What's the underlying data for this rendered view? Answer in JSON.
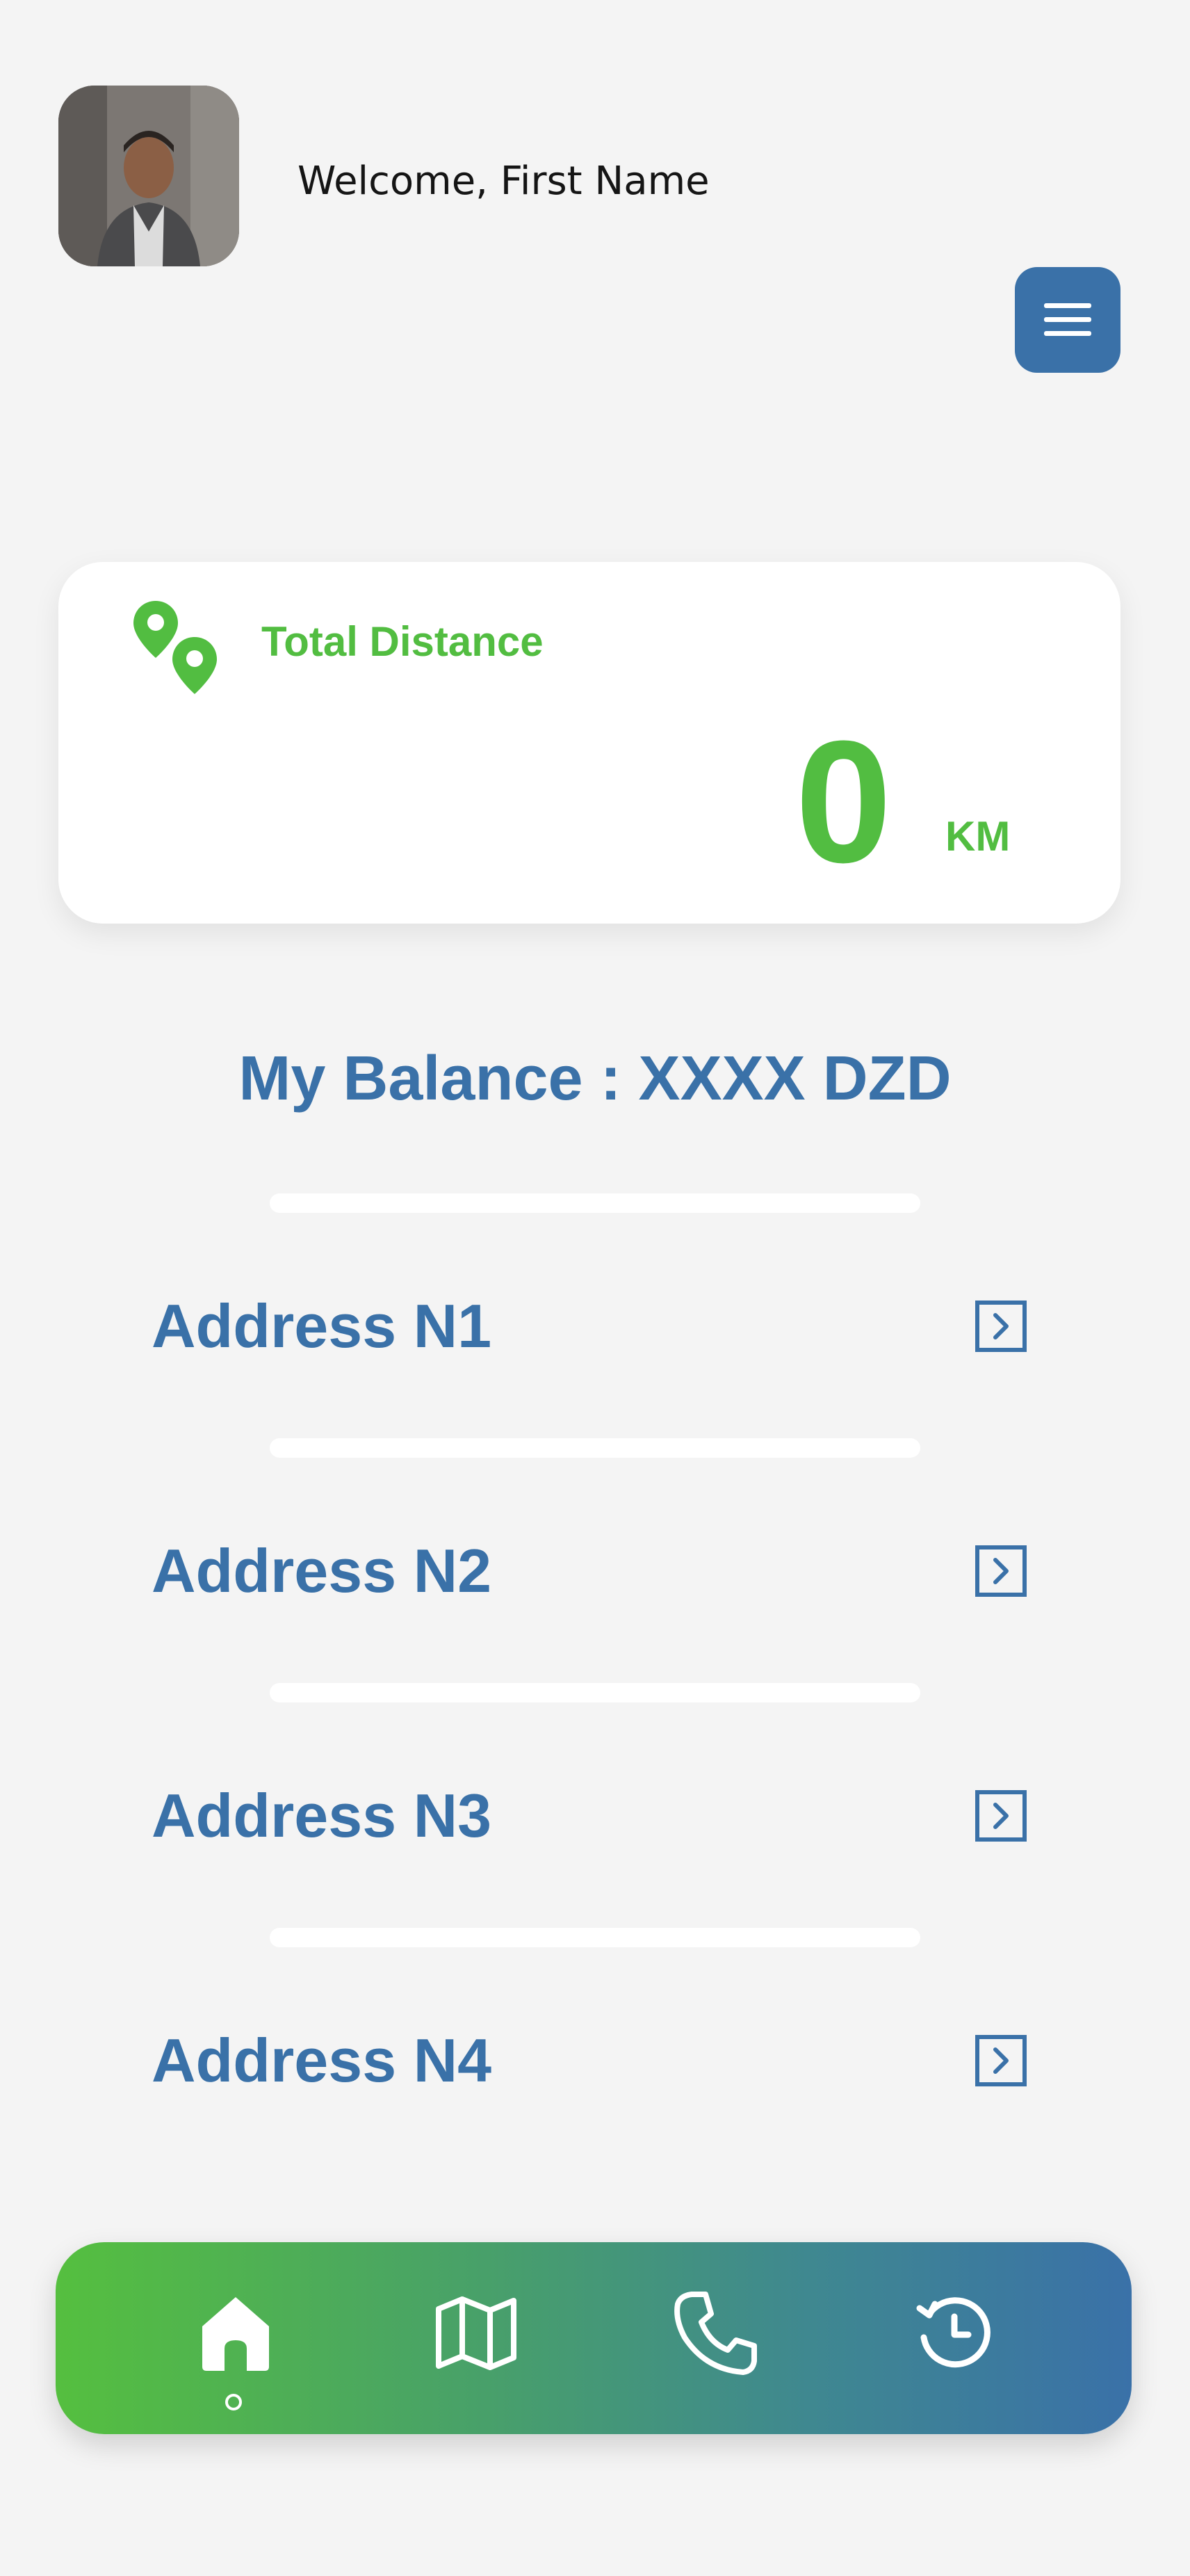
{
  "header": {
    "welcome_text": "Welcome, First Name",
    "avatar_icon": "user-avatar-photo",
    "menu_icon": "hamburger-menu-icon"
  },
  "distance_card": {
    "title": "Total Distance",
    "value": "0",
    "unit": "KM",
    "icon": "map-pins-icon"
  },
  "balance": {
    "text": "My Balance : XXXX DZD"
  },
  "addresses": [
    {
      "label": "Address N1",
      "icon": "arrow-right-square-icon"
    },
    {
      "label": "Address N2",
      "icon": "arrow-right-square-icon"
    },
    {
      "label": "Address N3",
      "icon": "arrow-right-square-icon"
    },
    {
      "label": "Address N4",
      "icon": "arrow-right-square-icon"
    }
  ],
  "bottom_nav": {
    "items": [
      {
        "icon": "home-icon",
        "active": true
      },
      {
        "icon": "map-icon",
        "active": false
      },
      {
        "icon": "phone-icon",
        "active": false
      },
      {
        "icon": "history-icon",
        "active": false
      }
    ]
  },
  "colors": {
    "brand_blue": "#3a71a8",
    "brand_green": "#52bd41",
    "background": "#f4f4f4"
  }
}
